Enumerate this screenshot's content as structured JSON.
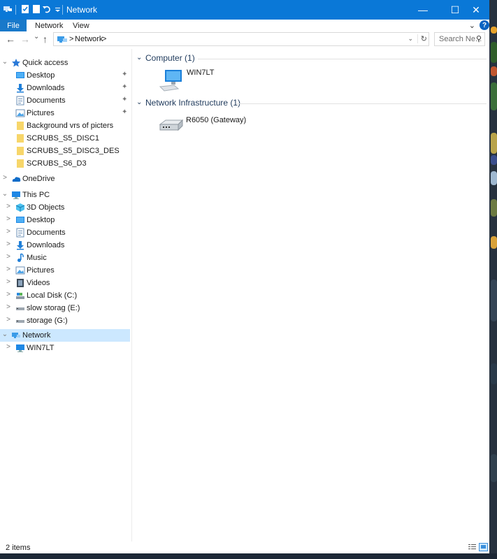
{
  "window": {
    "title": "Network",
    "minimize_glyph": "—",
    "maximize_glyph": "☐",
    "close_glyph": "✕",
    "accent": "#0a78d7"
  },
  "ribbon": {
    "file_label": "File",
    "tabs": [
      "Network",
      "View"
    ],
    "help_glyph": "?"
  },
  "address": {
    "back_glyph": "←",
    "forward_glyph": "→",
    "recent_glyph": "⌄",
    "up_glyph": "↑",
    "separator": ">",
    "crumb": "Network",
    "crumb_chevron": ">",
    "dropdown_glyph": "⌄",
    "refresh_glyph": "↻",
    "search_placeholder": "Search Ne...",
    "search_glyph": "⚲"
  },
  "nav": {
    "quick_access": {
      "label": "Quick access",
      "items": [
        {
          "label": "Desktop",
          "icon": "desktop-icon",
          "pinned": true
        },
        {
          "label": "Downloads",
          "icon": "downloads-icon",
          "pinned": true
        },
        {
          "label": "Documents",
          "icon": "documents-icon",
          "pinned": true
        },
        {
          "label": "Pictures",
          "icon": "pictures-icon",
          "pinned": true
        },
        {
          "label": "Background vrs of picters",
          "icon": "folder-icon",
          "pinned": false
        },
        {
          "label": "SCRUBS_S5_DISC1",
          "icon": "folder-icon",
          "pinned": false
        },
        {
          "label": "SCRUBS_S5_DISC3_DES",
          "icon": "folder-icon",
          "pinned": false
        },
        {
          "label": "SCRUBS_S6_D3",
          "icon": "folder-icon",
          "pinned": false
        }
      ]
    },
    "onedrive": {
      "label": "OneDrive"
    },
    "this_pc": {
      "label": "This PC",
      "items": [
        {
          "label": "3D Objects",
          "icon": "3d-objects-icon"
        },
        {
          "label": "Desktop",
          "icon": "desktop-icon"
        },
        {
          "label": "Documents",
          "icon": "documents-icon"
        },
        {
          "label": "Downloads",
          "icon": "downloads-icon"
        },
        {
          "label": "Music",
          "icon": "music-icon"
        },
        {
          "label": "Pictures",
          "icon": "pictures-icon"
        },
        {
          "label": "Videos",
          "icon": "videos-icon"
        },
        {
          "label": "Local Disk (C:)",
          "icon": "local-disk-icon"
        },
        {
          "label": "slow storag (E:)",
          "icon": "drive-icon"
        },
        {
          "label": "storage (G:)",
          "icon": "drive-icon"
        }
      ]
    },
    "network": {
      "label": "Network",
      "items": [
        {
          "label": "WIN7LT",
          "icon": "computer-icon"
        }
      ]
    },
    "expand_glyph": ">",
    "collapse_glyph": "⌄",
    "pin_glyph": "📌"
  },
  "content": {
    "groups": [
      {
        "title": "Computer (1)",
        "items": [
          {
            "label": "WIN7LT",
            "icon": "computer-icon"
          }
        ]
      },
      {
        "title": "Network Infrastructure (1)",
        "items": [
          {
            "label": "R6050 (Gateway)",
            "icon": "router-icon"
          }
        ]
      }
    ],
    "group_chevron": "⌄"
  },
  "status": {
    "items_text": "2 items"
  }
}
